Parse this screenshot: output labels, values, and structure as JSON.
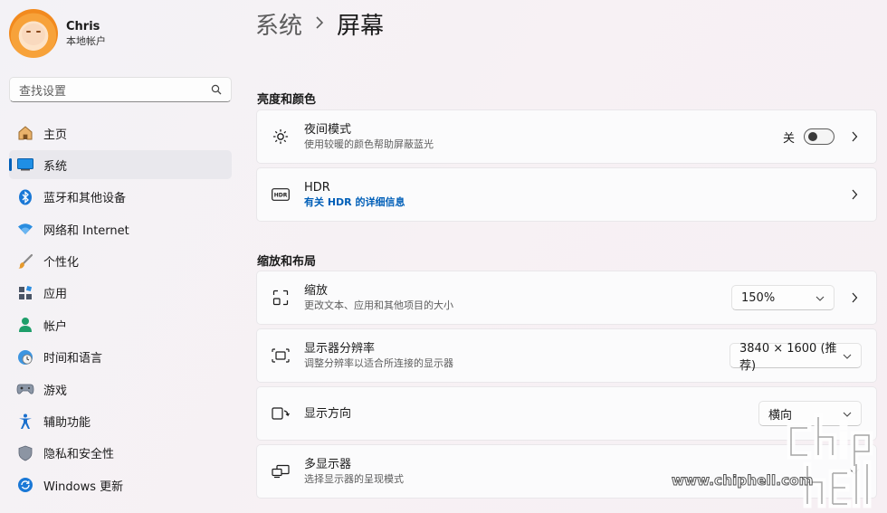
{
  "profile": {
    "name": "Chris",
    "account_type": "本地帐户"
  },
  "search": {
    "placeholder": "查找设置"
  },
  "nav": {
    "items": [
      {
        "label": "主页",
        "icon": "home-icon"
      },
      {
        "label": "系统",
        "icon": "system-icon",
        "active": true
      },
      {
        "label": "蓝牙和其他设备",
        "icon": "bluetooth-icon"
      },
      {
        "label": "网络和 Internet",
        "icon": "wifi-icon"
      },
      {
        "label": "个性化",
        "icon": "brush-icon"
      },
      {
        "label": "应用",
        "icon": "apps-icon"
      },
      {
        "label": "帐户",
        "icon": "account-icon"
      },
      {
        "label": "时间和语言",
        "icon": "globe-clock-icon"
      },
      {
        "label": "游戏",
        "icon": "gamepad-icon"
      },
      {
        "label": "辅助功能",
        "icon": "accessibility-icon"
      },
      {
        "label": "隐私和安全性",
        "icon": "shield-icon"
      },
      {
        "label": "Windows 更新",
        "icon": "update-icon"
      }
    ]
  },
  "breadcrumb": {
    "parent": "系统",
    "current": "屏幕"
  },
  "sections": {
    "brightness": "亮度和颜色",
    "scale": "缩放和布局"
  },
  "cards": {
    "night_light": {
      "title": "夜间模式",
      "subtitle": "使用较暖的颜色帮助屏蔽蓝光",
      "state": "关"
    },
    "hdr": {
      "title": "HDR",
      "link": "有关 HDR 的详细信息"
    },
    "scale": {
      "title": "缩放",
      "subtitle": "更改文本、应用和其他项目的大小",
      "value": "150%"
    },
    "resolution": {
      "title": "显示器分辨率",
      "subtitle": "调整分辨率以适合所连接的显示器",
      "value": "3840 × 1600 (推荐)"
    },
    "orientation": {
      "title": "显示方向",
      "value": "横向"
    },
    "multi_display": {
      "title": "多显示器",
      "subtitle": "选择显示器的呈现模式"
    }
  },
  "watermark": {
    "text": "www.chiphell.com",
    "logo_text": "chip hell"
  },
  "colors": {
    "accent": "#005fb8",
    "text": "#1b1b1b",
    "secondary": "#5d5d5d"
  }
}
